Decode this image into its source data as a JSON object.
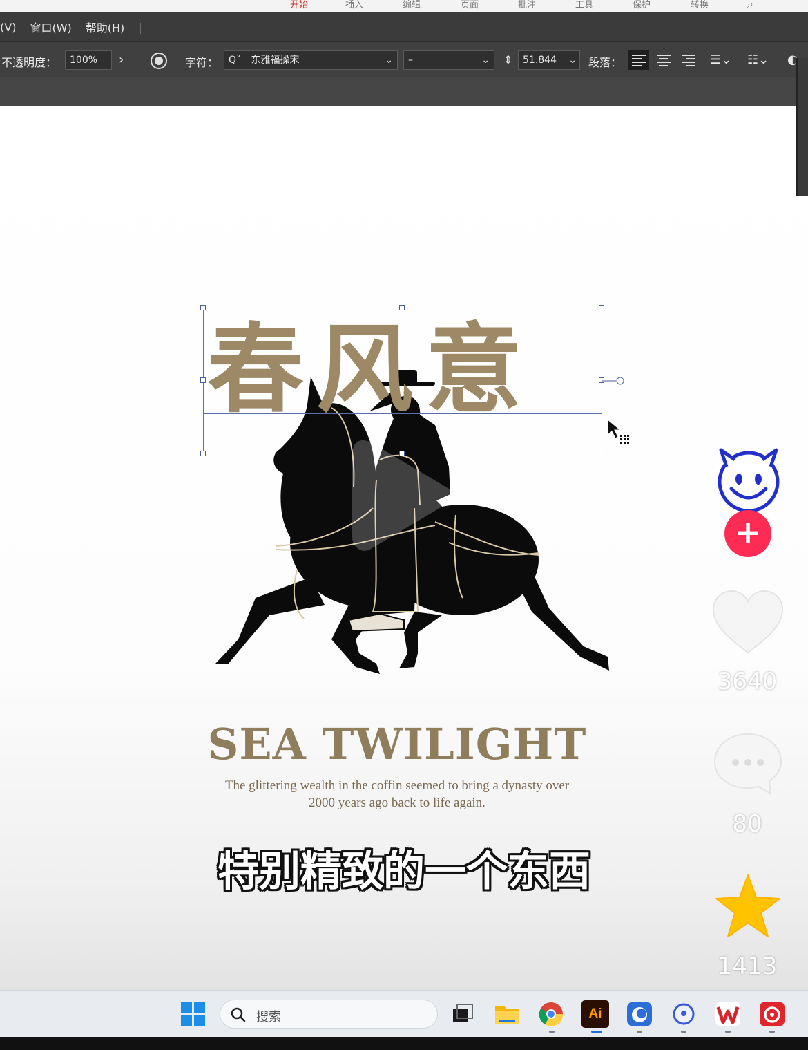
{
  "top_ribbon": {
    "items": [
      "开始",
      "插入",
      "编辑",
      "页面",
      "批注",
      "工具",
      "保护",
      "转换"
    ],
    "active_index": 0
  },
  "menubar": {
    "items": [
      "(V)",
      "窗口(W)",
      "帮助(H)"
    ]
  },
  "controlbar": {
    "opacity_label": "不透明度：",
    "opacity_value": "100%",
    "more_arrow": "›",
    "char_label": "字符：",
    "font_search_glyph": "Q˅",
    "font_name": "东雅福操宋",
    "font_style": "–",
    "font_size": "51.844",
    "para_label": "段落："
  },
  "artboard": {
    "cn_title": "春风意",
    "en_title": "SEA TWILIGHT",
    "en_subtitle_line1": "The glittering wealth in the coffin seemed to bring a dynasty over",
    "en_subtitle_line2": "2000 years ago back to life again."
  },
  "video_caption": "特别精致的一个东西",
  "right_rail": {
    "follow_symbol": "+",
    "likes": "3640",
    "comments": "80",
    "favorites": "1413"
  },
  "taskbar": {
    "search_placeholder": "搜索",
    "ai_label": "Ai"
  },
  "colors": {
    "gold": "#9d8966",
    "menubar": "#3b3b3b",
    "follow": "#fe2c55",
    "star": "#ffc300"
  }
}
